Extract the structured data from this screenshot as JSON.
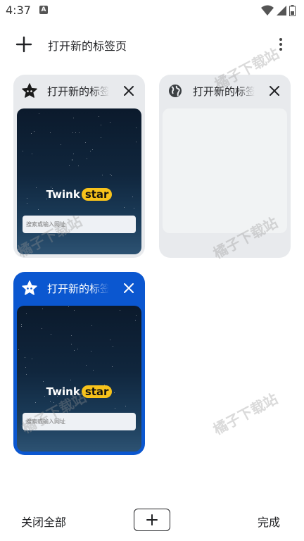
{
  "status_bar": {
    "time": "4:37",
    "notification_badge": "A"
  },
  "toolbar": {
    "new_tab_label": "打开新的标签页"
  },
  "tabs": [
    {
      "title": "打开新的标签页",
      "favicon": "twinkstar-star-icon",
      "preview": "twinkstar-home",
      "brand_twink": "Twink",
      "brand_star": "star",
      "search_placeholder": "搜索或输入网址",
      "selected": false
    },
    {
      "title": "打开新的标签页",
      "favicon": "globe-icon",
      "preview": "blank",
      "selected": false
    },
    {
      "title": "打开新的标签页",
      "favicon": "twinkstar-star-icon",
      "preview": "twinkstar-home",
      "brand_twink": "Twink",
      "brand_star": "star",
      "search_placeholder": "搜索或输入网址",
      "selected": true
    }
  ],
  "watermark_text": "橘子下载站",
  "bottom_bar": {
    "close_all": "关闭全部",
    "done": "完成"
  },
  "colors": {
    "selected_tab": "#0b57d0",
    "tab_bg": "#e8eaed",
    "brand_yellow": "#f7c21b"
  }
}
